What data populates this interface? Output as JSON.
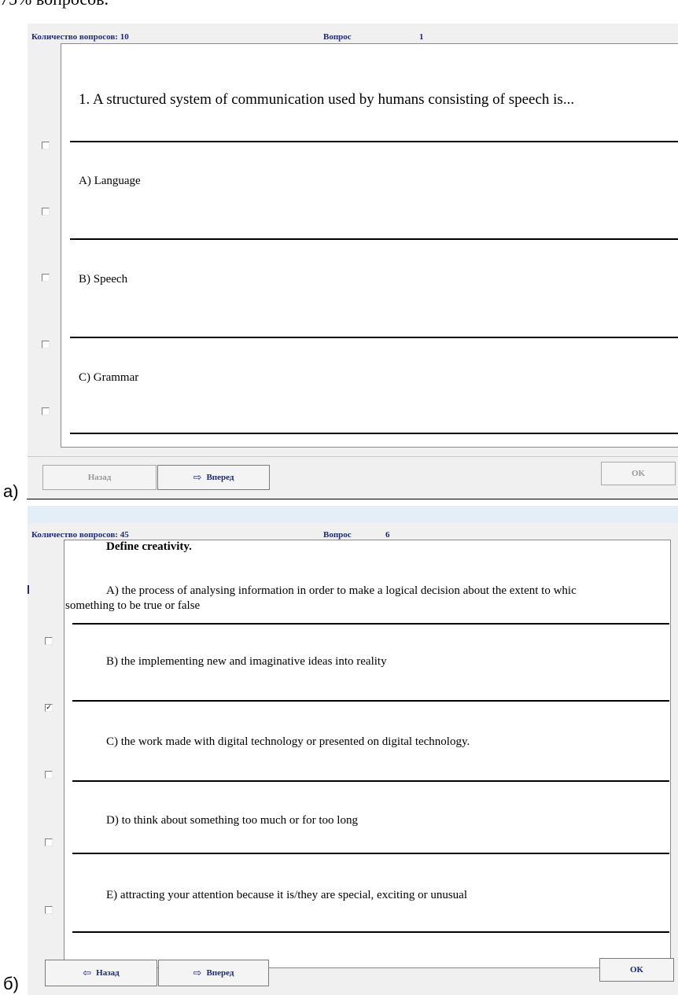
{
  "page_caption_top": "75% вопросов.",
  "label_a": "а)",
  "label_b": "б)",
  "screen_a": {
    "question_count_label": "Количество вопросов: 10",
    "question_label": "Вопрос",
    "question_number": "1",
    "question_text": "1. A structured system of communication used by humans consisting of speech is...",
    "answers": [
      "A) Language",
      "B) Speech",
      "C) Grammar"
    ],
    "checkbox_states": [
      false,
      false,
      false,
      false,
      false
    ],
    "back_button": "Назад",
    "next_button": "Вперед",
    "ok_button": "OK"
  },
  "screen_b": {
    "question_count_label": "Количество вопросов: 45",
    "question_label": "Вопрос",
    "question_number": "6",
    "question_text": "Define creativity.",
    "answer_a_line1": "A) the process of analysing information in order to make a logical decision about the extent to whic",
    "answer_a_line2": "something to be true or false",
    "answers": [
      "B) the implementing new and imaginative ideas into reality",
      "C) the work made with digital technology or presented on digital technology.",
      "D) to think about something too much or for too long",
      "E) attracting your attention because it is/they are special, exciting or unusual"
    ],
    "checkbox_states": [
      false,
      true,
      false,
      false,
      false
    ],
    "back_button": "Назад",
    "next_button": "Вперед",
    "ok_button": "OK"
  },
  "icons": {
    "back_arrow": "left-arrow-icon",
    "next_arrow": "right-arrow-icon"
  },
  "colors": {
    "header_text": "#1c2a7a",
    "panel_bg": "#f0f0f0",
    "content_bg": "#ffffff"
  }
}
